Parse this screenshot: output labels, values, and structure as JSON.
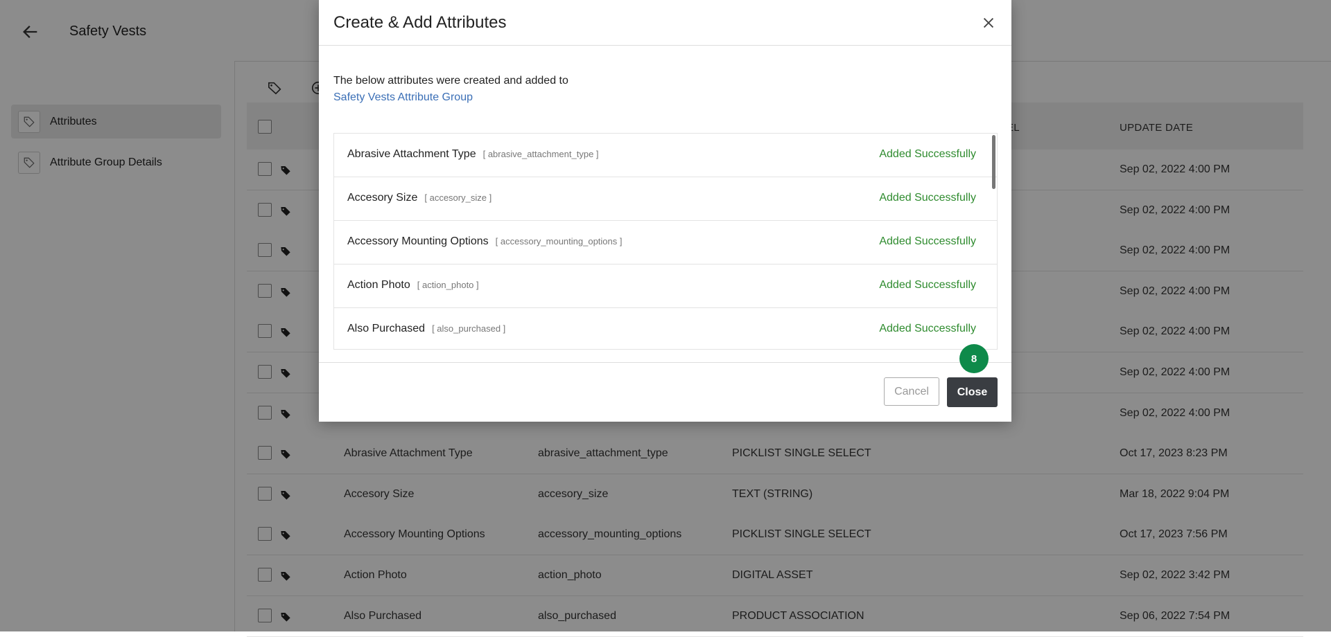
{
  "header": {
    "title": "Safety Vests"
  },
  "sidebar": {
    "items": [
      {
        "label": "Attributes"
      },
      {
        "label": "Attribute Group Details"
      }
    ]
  },
  "table": {
    "columns": {
      "label_partial": "EL",
      "update_date": "UPDATE DATE"
    },
    "top_rows": [
      {
        "update_date": "Sep 02, 2022 4:00 PM"
      },
      {
        "update_date": "Sep 02, 2022 4:00 PM"
      },
      {
        "update_date": "Sep 02, 2022 4:00 PM"
      },
      {
        "update_date": "Sep 02, 2022 4:00 PM"
      },
      {
        "update_date": "Sep 02, 2022 4:00 PM"
      },
      {
        "update_date": "Sep 02, 2022 4:00 PM"
      },
      {
        "update_date": "Sep 02, 2022 4:00 PM"
      }
    ],
    "rows": [
      {
        "name": "Abrasive Attachment Type",
        "key": "abrasive_attachment_type",
        "type": "PICKLIST SINGLE SELECT",
        "update_date": "Oct 17, 2023 8:23 PM"
      },
      {
        "name": "Accesory Size",
        "key": "accesory_size",
        "type": "TEXT (STRING)",
        "update_date": "Mar 18, 2022 9:04 PM"
      },
      {
        "name": "Accessory Mounting Options",
        "key": "accessory_mounting_options",
        "type": "PICKLIST SINGLE SELECT",
        "update_date": "Oct 17, 2023 7:56 PM"
      },
      {
        "name": "Action Photo",
        "key": "action_photo",
        "type": "DIGITAL ASSET",
        "update_date": "Sep 02, 2022 3:42 PM"
      },
      {
        "name": "Also Purchased",
        "key": "also_purchased",
        "type": "PRODUCT ASSOCIATION",
        "update_date": "Sep 06, 2022 7:54 PM"
      }
    ]
  },
  "modal": {
    "title": "Create & Add Attributes",
    "description": "The below attributes were created and added to",
    "group_link": "Safety Vests Attribute Group",
    "items": [
      {
        "name": "Abrasive Attachment Type",
        "key": "[ abrasive_attachment_type ]",
        "status": "Added Successfully"
      },
      {
        "name": "Accesory Size",
        "key": "[ accesory_size ]",
        "status": "Added Successfully"
      },
      {
        "name": "Accessory Mounting Options",
        "key": "[ accessory_mounting_options ]",
        "status": "Added Successfully"
      },
      {
        "name": "Action Photo",
        "key": "[ action_photo ]",
        "status": "Added Successfully"
      },
      {
        "name": "Also Purchased",
        "key": "[ also_purchased ]",
        "status": "Added Successfully"
      }
    ],
    "cancel_label": "Cancel",
    "close_label": "Close",
    "step_badge": "8"
  },
  "colors": {
    "success": "#2e8b2e",
    "link": "#3b6fb6",
    "badge": "#0e8a4a",
    "primary_button": "#3a3d42"
  }
}
